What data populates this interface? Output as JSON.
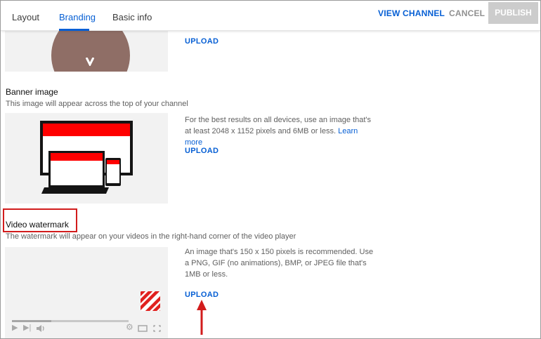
{
  "tabs": [
    {
      "label": "Layout"
    },
    {
      "label": "Branding"
    },
    {
      "label": "Basic info"
    }
  ],
  "actions": {
    "view_channel": "VIEW CHANNEL",
    "cancel": "CANCEL",
    "publish": "PUBLISH"
  },
  "picture": {
    "upload": "UPLOAD"
  },
  "banner": {
    "title": "Banner image",
    "subtitle": "This image will appear across the top of your channel",
    "description": "For the best results on all devices, use an image that's at least 2048 x 1152 pixels and 6MB or less.",
    "learn_more": "Learn more",
    "upload": "UPLOAD"
  },
  "watermark": {
    "title": "Video watermark",
    "subtitle": "The watermark will appear on your videos in the right-hand corner of the video player",
    "description": "An image that's 150 x 150 pixels is recommended. Use a PNG, GIF (no animations), BMP, or JPEG file that's 1MB or less.",
    "upload": "UPLOAD",
    "player_progress": 0.34
  },
  "icons": {
    "play": "play-icon",
    "next": "next-icon",
    "volume": "volume-icon",
    "settings": "gear-icon",
    "theater": "theater-mode-icon",
    "fullscreen": "fullscreen-icon",
    "watermark": "striped-watermark-icon"
  },
  "colors": {
    "accent": "#065fd4",
    "annotation": "#d21c1c",
    "publish_disabled": "#cccccc"
  }
}
